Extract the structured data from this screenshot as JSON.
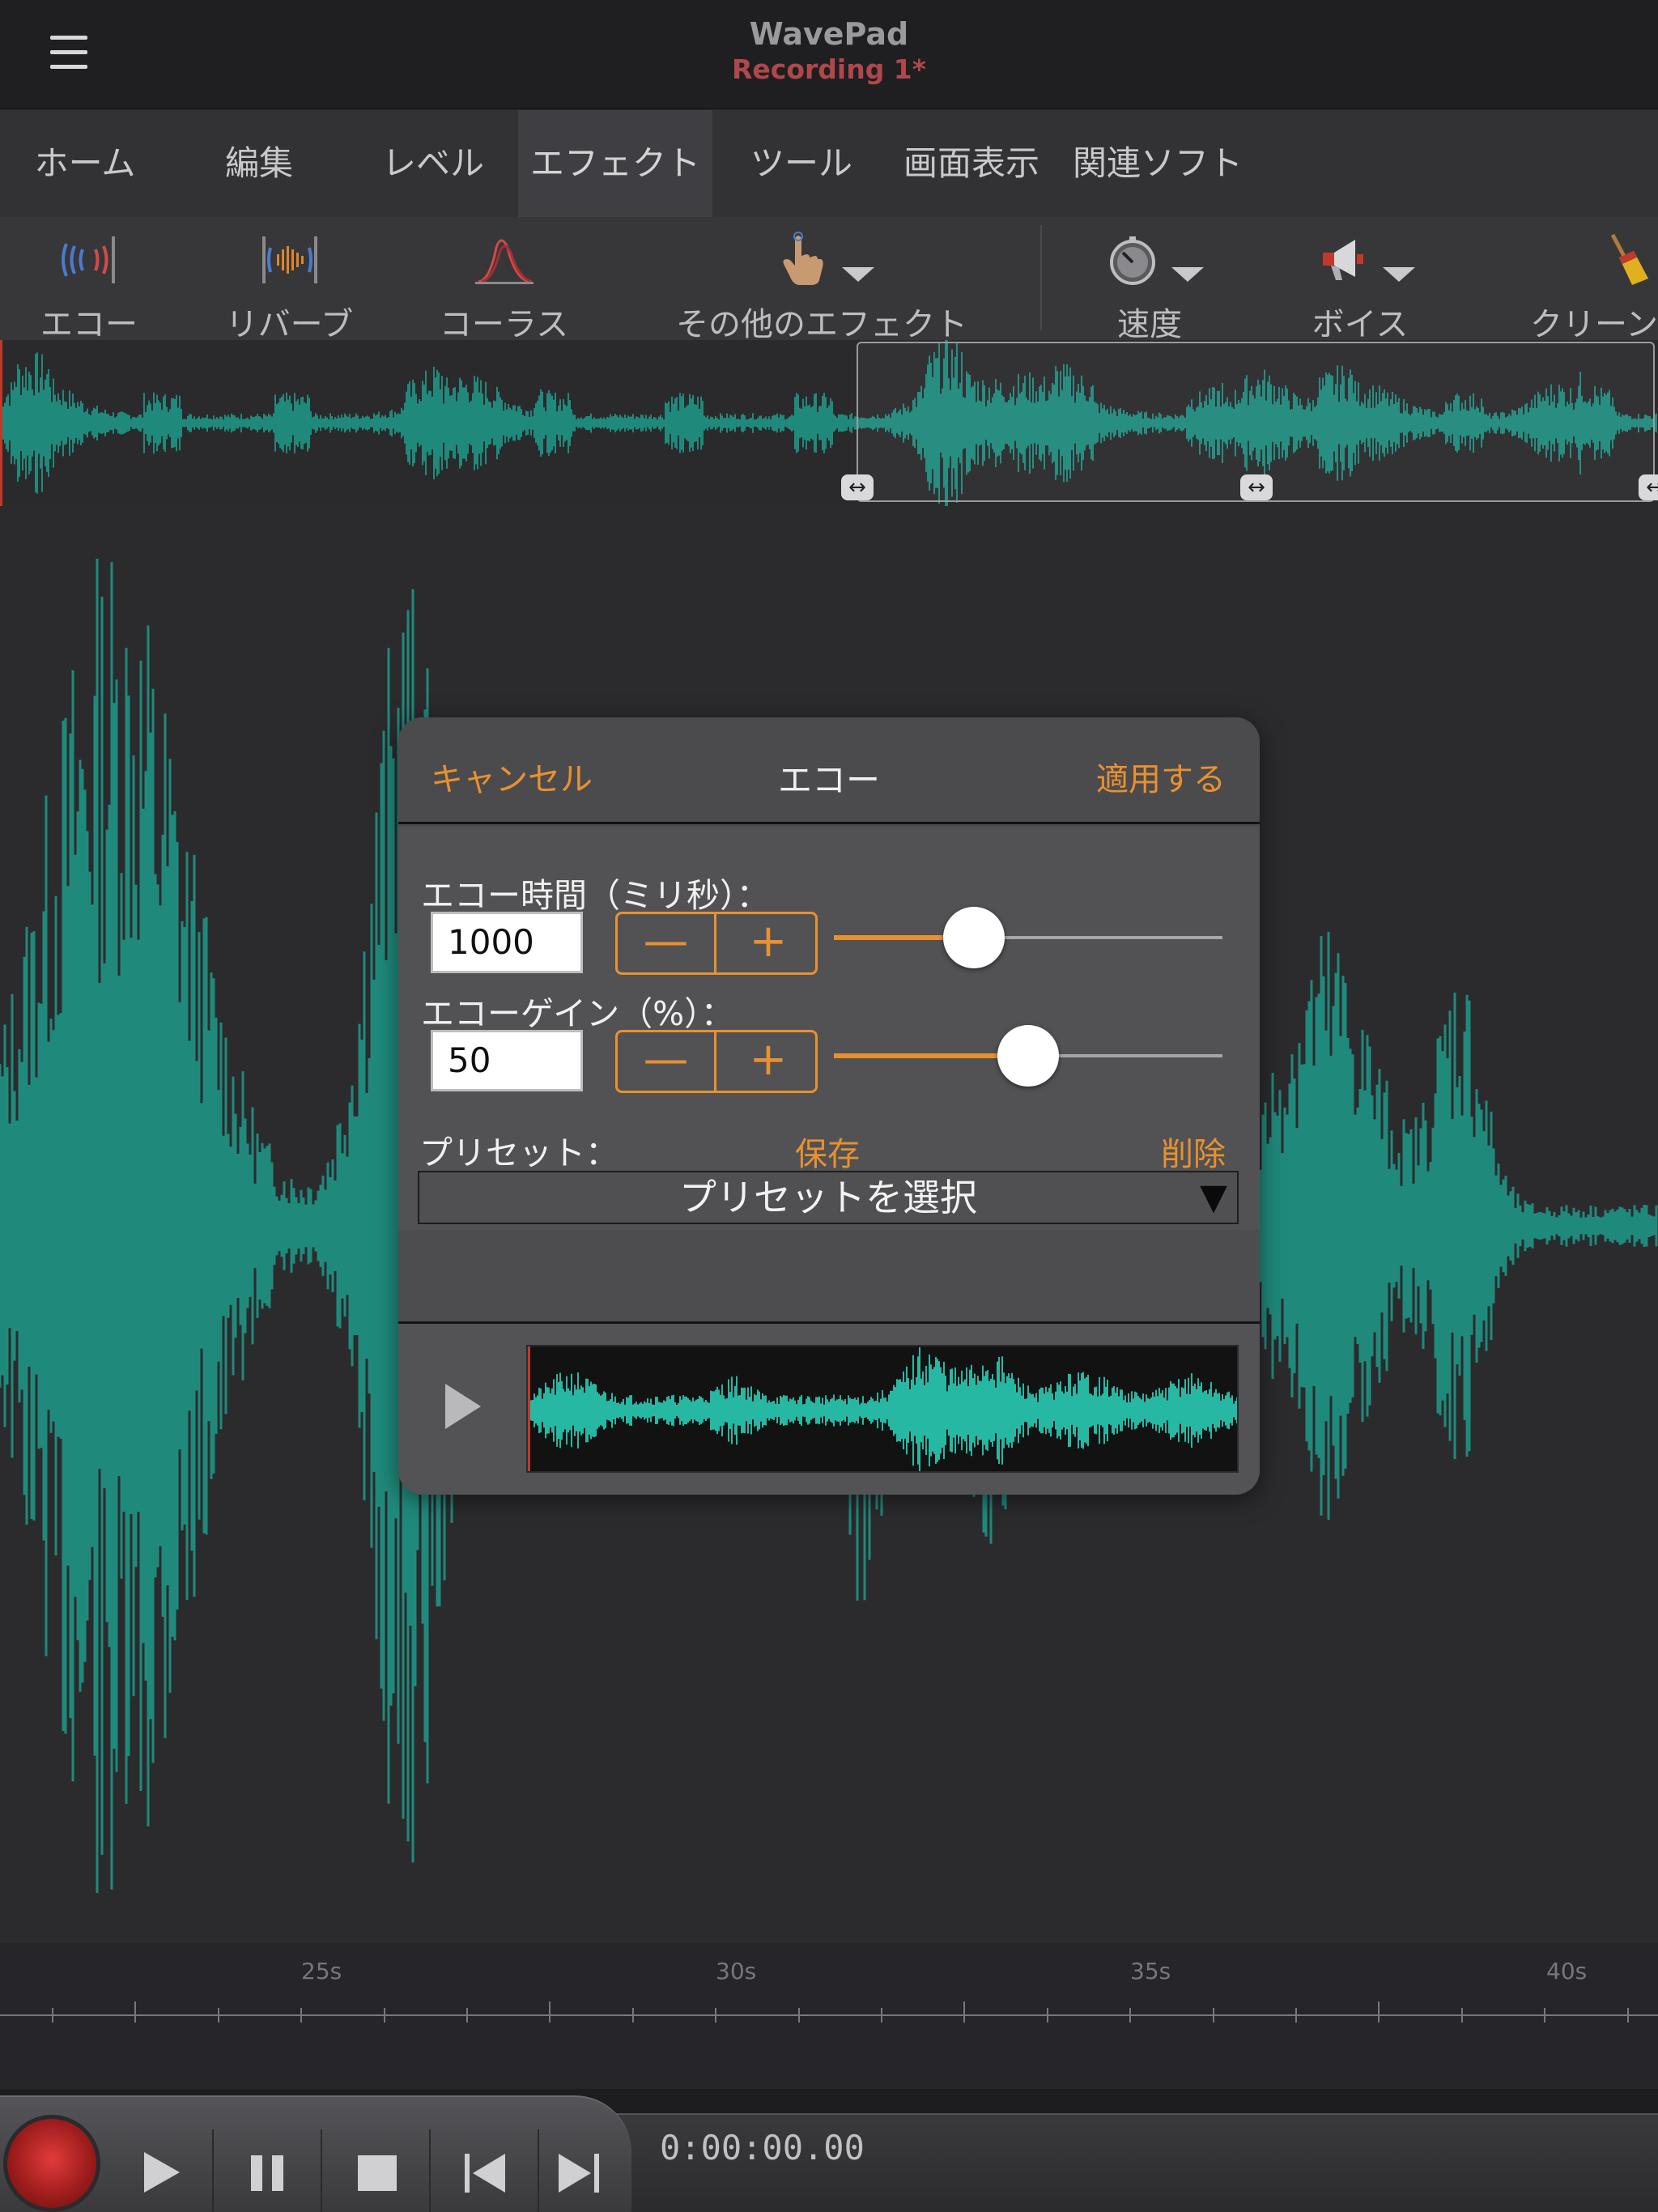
{
  "app": {
    "name": "WavePad",
    "document": "Recording 1*"
  },
  "tabs": [
    {
      "label": "ホーム",
      "active": false
    },
    {
      "label": "編集",
      "active": false
    },
    {
      "label": "レベル",
      "active": false
    },
    {
      "label": "エフェクト",
      "active": true
    },
    {
      "label": "ツール",
      "active": false
    },
    {
      "label": "画面表示",
      "active": false
    },
    {
      "label": "関連ソフト",
      "active": false
    }
  ],
  "toolbar": {
    "items": [
      {
        "label": "エコー",
        "icon": "echo-icon"
      },
      {
        "label": "リバーブ",
        "icon": "reverb-icon"
      },
      {
        "label": "コーラス",
        "icon": "chorus-icon"
      },
      {
        "label": "その他のエフェクト",
        "icon": "more-effects-hand-icon"
      },
      {
        "label": "速度",
        "icon": "speed-gauge-icon"
      },
      {
        "label": "ボイス",
        "icon": "megaphone-icon"
      },
      {
        "label": "クリーン",
        "icon": "broom-icon"
      }
    ]
  },
  "timeline": {
    "labels": [
      "25s",
      "30s",
      "35s",
      "40s"
    ]
  },
  "transport": {
    "time": "0:00:00.00",
    "buttons": [
      "record",
      "play",
      "pause",
      "stop",
      "skip-to-start",
      "skip-to-end"
    ]
  },
  "dialog": {
    "title": "エコー",
    "cancel": "キャンセル",
    "apply": "適用する",
    "params": [
      {
        "label": "エコー時間（ミリ秒）：",
        "value": "1000",
        "slider_fraction": 0.36
      },
      {
        "label": "エコーゲイン（%）：",
        "value": "50",
        "slider_fraction": 0.5
      }
    ],
    "stepper": {
      "minus": "—",
      "plus": "+"
    },
    "preset": {
      "label": "プリセット：",
      "save": "保存",
      "delete": "削除",
      "select_placeholder": "プリセットを選択",
      "arrow": "▼"
    }
  },
  "colors": {
    "accent": "#e8912f",
    "waveform": "#1f8a7c",
    "preview_waveform": "#27b8a4",
    "document_title": "#b0474a"
  }
}
